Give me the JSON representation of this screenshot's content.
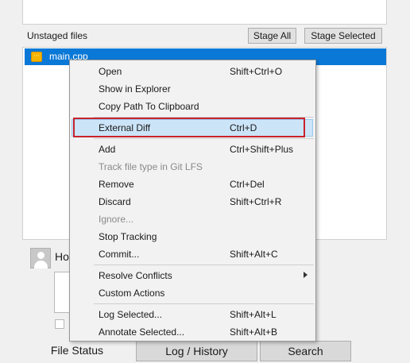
{
  "unstaged": {
    "title": "Unstaged files",
    "stage_all_label": "Stage All",
    "stage_selected_label": "Stage Selected",
    "files": [
      {
        "name": "main.cpp",
        "status_icon": "modified-file-icon",
        "selected": true
      }
    ]
  },
  "commit": {
    "author_fragment": "Ho"
  },
  "tabs": [
    {
      "label": "File Status"
    },
    {
      "label": "Log / History"
    },
    {
      "label": "Search"
    }
  ],
  "context_menu": {
    "items": [
      {
        "label": "Open",
        "shortcut": "Shift+Ctrl+O"
      },
      {
        "label": "Show in Explorer",
        "shortcut": ""
      },
      {
        "label": "Copy Path To Clipboard",
        "shortcut": ""
      },
      {
        "label": "External Diff",
        "shortcut": "Ctrl+D"
      },
      {
        "label": "Add",
        "shortcut": "Ctrl+Shift+Plus"
      },
      {
        "label": "Track file type in Git LFS",
        "shortcut": "",
        "disabled": true
      },
      {
        "label": "Remove",
        "shortcut": "Ctrl+Del"
      },
      {
        "label": "Discard",
        "shortcut": "Shift+Ctrl+R"
      },
      {
        "label": "Ignore...",
        "shortcut": "",
        "disabled": true
      },
      {
        "label": "Stop Tracking",
        "shortcut": ""
      },
      {
        "label": "Commit...",
        "shortcut": "Shift+Alt+C"
      },
      {
        "label": "Resolve Conflicts",
        "shortcut": "",
        "submenu": true
      },
      {
        "label": "Custom Actions",
        "shortcut": ""
      },
      {
        "label": "Log Selected...",
        "shortcut": "Shift+Alt+L"
      },
      {
        "label": "Annotate Selected...",
        "shortcut": "Shift+Alt+B"
      }
    ]
  },
  "colors": {
    "selection": "#0a78d7",
    "menu_highlight": "#cce4f7",
    "callout_outline": "#c8232c"
  }
}
